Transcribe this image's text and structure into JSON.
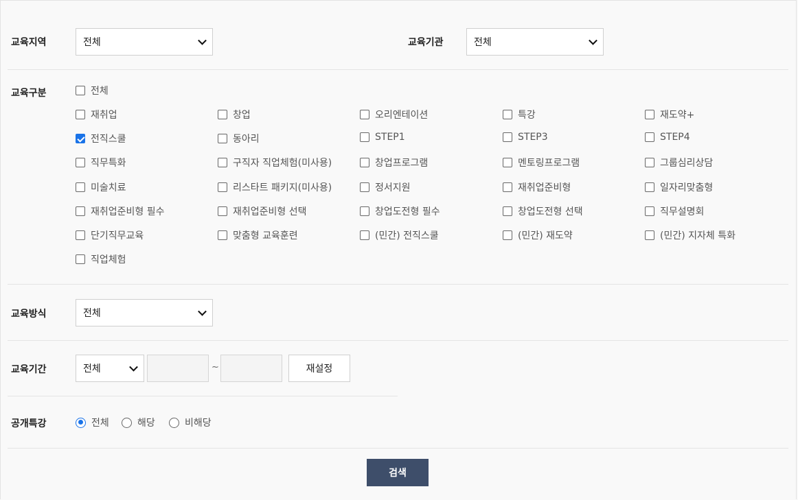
{
  "region": {
    "label": "교육지역",
    "value": "전체"
  },
  "institution": {
    "label": "교육기관",
    "value": "전체"
  },
  "category": {
    "label": "교육구분",
    "all": {
      "text": "전체",
      "checked": false
    },
    "items": [
      {
        "text": "재취업",
        "checked": false
      },
      {
        "text": "창업",
        "checked": false
      },
      {
        "text": "오리엔테이션",
        "checked": false
      },
      {
        "text": "특강",
        "checked": false
      },
      {
        "text": "재도약+",
        "checked": false
      },
      {
        "text": "전직스쿨",
        "checked": true
      },
      {
        "text": "동아리",
        "checked": false
      },
      {
        "text": "STEP1",
        "checked": false
      },
      {
        "text": "STEP3",
        "checked": false
      },
      {
        "text": "STEP4",
        "checked": false
      },
      {
        "text": "직무특화",
        "checked": false
      },
      {
        "text": "구직자 직업체험(미사용)",
        "checked": false
      },
      {
        "text": "창업프로그램",
        "checked": false
      },
      {
        "text": "멘토링프로그램",
        "checked": false
      },
      {
        "text": "그룹심리상담",
        "checked": false
      },
      {
        "text": "미술치료",
        "checked": false
      },
      {
        "text": "리스타트 패키지(미사용)",
        "checked": false
      },
      {
        "text": "정서지원",
        "checked": false
      },
      {
        "text": "재취업준비형",
        "checked": false
      },
      {
        "text": "일자리맞춤형",
        "checked": false
      },
      {
        "text": "재취업준비형 필수",
        "checked": false
      },
      {
        "text": "재취업준비형 선택",
        "checked": false
      },
      {
        "text": "창업도전형 필수",
        "checked": false
      },
      {
        "text": "창업도전형 선택",
        "checked": false
      },
      {
        "text": "직무설명회",
        "checked": false
      },
      {
        "text": "단기직무교육",
        "checked": false
      },
      {
        "text": "맞춤형 교육훈련",
        "checked": false
      },
      {
        "text": "(민간) 전직스쿨",
        "checked": false
      },
      {
        "text": "(민간) 재도약",
        "checked": false
      },
      {
        "text": "(민간) 지자체 특화",
        "checked": false
      },
      {
        "text": "직업체험",
        "checked": false
      }
    ]
  },
  "method": {
    "label": "교육방식",
    "value": "전체"
  },
  "period": {
    "label": "교육기간",
    "value": "전체",
    "start": "",
    "end": "",
    "separator": "~",
    "reset_label": "재설정"
  },
  "open_lecture": {
    "label": "공개특강",
    "options": [
      {
        "text": "전체",
        "selected": true
      },
      {
        "text": "해당",
        "selected": false
      },
      {
        "text": "비해당",
        "selected": false
      }
    ]
  },
  "search_label": "검색",
  "colors": {
    "accent": "#1a73e8",
    "search_button": "#3e4e6a"
  }
}
